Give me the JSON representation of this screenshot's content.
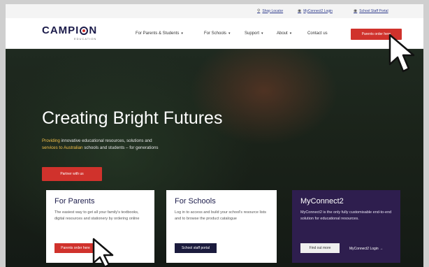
{
  "utility": {
    "links": [
      {
        "label": "Shop Locator",
        "icon": "pin-icon"
      },
      {
        "label": "MyConnect2 Login",
        "icon": "user-icon"
      },
      {
        "label": "School Staff Portal",
        "icon": "user-icon"
      }
    ]
  },
  "logo": {
    "text_pre": "CAMPI",
    "text_post": "N",
    "tagline": "EDUCATION"
  },
  "nav": {
    "items": [
      {
        "label": "For Parents & Students",
        "dropdown": true
      },
      {
        "label": "For Schools",
        "dropdown": true
      },
      {
        "label": "Support",
        "dropdown": true
      },
      {
        "label": "About",
        "dropdown": true
      },
      {
        "label": "Contact us",
        "dropdown": false
      }
    ],
    "button_label": "Parents order here"
  },
  "hero": {
    "title": "Creating Bright Futures",
    "subtitle_highlight": "Providing",
    "subtitle_rest": " innovative educational resources, solutions and",
    "subtitle_line2_highlight": "services to Australian",
    "subtitle_line2_rest": " schools and students – for generations",
    "button_label": "Partner with us"
  },
  "cards": {
    "parents": {
      "title": "For Parents",
      "body": "The easiest way to get all your family's textbooks, digital resources and stationery by ordering online",
      "button_label": "Parents order here"
    },
    "schools": {
      "title": "For Schools",
      "body": "Log in to access and build your school's resource lists and to browse the product catalogue",
      "button_label": "School staff portal"
    },
    "connect": {
      "title": "MyConnect2",
      "body": "MyConnect2 is the only fully customisable end-to-end solution for educational resources.",
      "button_label": "Find out more",
      "link_label": "MyConnect2 Login →"
    }
  },
  "colors": {
    "brand_red": "#d0322c",
    "brand_navy": "#1b1b4a",
    "connect_purple": "#2e1e4e",
    "highlight_yellow": "#f3c04b"
  }
}
